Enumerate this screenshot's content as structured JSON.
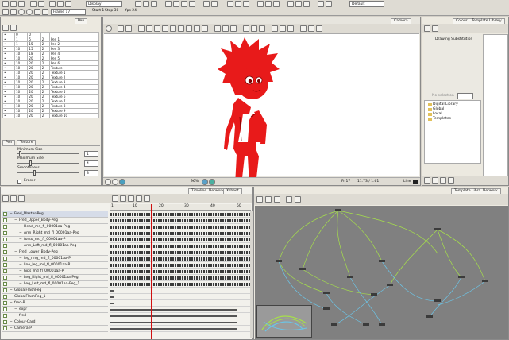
{
  "toolbar": {
    "display_label": "Display",
    "frame_label": "Frame 17",
    "start_label": "Start 1",
    "stop_label": "Stop 30",
    "fps_label": "fps 24",
    "default_label": "Default"
  },
  "pen_panel": {
    "tab_pen": "Pen",
    "rows": [
      {
        "a": "",
        "b": "0",
        "c": "0",
        "d": "",
        "name": ""
      },
      {
        "a": "",
        "b": "1",
        "c": "5",
        "d": "2",
        "name": "Pen 1"
      },
      {
        "a": "",
        "b": "1",
        "c": "15",
        "d": "2",
        "name": "Pen 2"
      },
      {
        "a": "",
        "b": "10",
        "c": "15",
        "d": "2",
        "name": "Pen 3"
      },
      {
        "a": "",
        "b": "10",
        "c": "18",
        "d": "2",
        "name": "Pen 4"
      },
      {
        "a": "",
        "b": "10",
        "c": "20",
        "d": "2",
        "name": "Pen 5"
      },
      {
        "a": "",
        "b": "10",
        "c": "20",
        "d": "2",
        "name": "Pen 6"
      },
      {
        "a": "",
        "b": "10",
        "c": "20",
        "d": "2",
        "name": "Texture"
      },
      {
        "a": "",
        "b": "10",
        "c": "20",
        "d": "2",
        "name": "Texture 1"
      },
      {
        "a": "",
        "b": "10",
        "c": "20",
        "d": "2",
        "name": "Texture 2"
      },
      {
        "a": "",
        "b": "10",
        "c": "20",
        "d": "2",
        "name": "Texture 3"
      },
      {
        "a": "",
        "b": "10",
        "c": "20",
        "d": "2",
        "name": "Texture 4"
      },
      {
        "a": "",
        "b": "10",
        "c": "20",
        "d": "2",
        "name": "Texture 5"
      },
      {
        "a": "",
        "b": "10",
        "c": "20",
        "d": "2",
        "name": "Texture 6"
      },
      {
        "a": "",
        "b": "10",
        "c": "20",
        "d": "2",
        "name": "Texture 7"
      },
      {
        "a": "",
        "b": "10",
        "c": "20",
        "d": "2",
        "name": "Texture 8"
      },
      {
        "a": "",
        "b": "10",
        "c": "20",
        "d": "2",
        "name": "Texture 9"
      },
      {
        "a": "",
        "b": "10",
        "c": "20",
        "d": "2",
        "name": "Texture 10"
      }
    ],
    "tab_pen2": "Pen",
    "tab_texture": "Texture",
    "min_size_label": "Minimum Size",
    "min_size_value": "1",
    "max_size_label": "Maximum Size",
    "max_size_value": "4",
    "smoothness_label": "Smoothness",
    "smoothness_value": "3",
    "eraser_label": "Eraser"
  },
  "camera": {
    "tab": "Camera",
    "zoom": "96%",
    "frame_readout": "Fr 17",
    "coords_readout": "11.73 / 1.61",
    "line_label": "Line"
  },
  "color_panel": {
    "tab_colour": "Colour",
    "tab_library": "Template Library",
    "drawing_substitution": "Drawing Substitution",
    "no_selection": "No selection",
    "tree": [
      "Digital Library",
      "Global",
      "Local",
      "Templates"
    ]
  },
  "timeline": {
    "tab_timeline": "Timeline",
    "tab_network": "Network",
    "tab_xsheet": "Xsheet",
    "ruler": [
      "1",
      "10",
      "20",
      "30",
      "40",
      "50"
    ],
    "current_frame": 17,
    "total_frames": 55,
    "layers": [
      {
        "name": "Fred_Master-Peg",
        "indent": 0,
        "keys": true
      },
      {
        "name": "Fred_Upper_Body-Peg",
        "indent": 1,
        "keys": true
      },
      {
        "name": "Head_md_fl_00001aa-Peg",
        "indent": 2,
        "keys": true
      },
      {
        "name": "Arm_Right_md_fl_00001aa-Peg",
        "indent": 2,
        "keys": true
      },
      {
        "name": "torso_md_fl_00001aa-P",
        "indent": 2,
        "keys": true
      },
      {
        "name": "Arm_Left_md_fl_00001aa-Peg",
        "indent": 2,
        "keys": true
      },
      {
        "name": "Fred_Lower_Body-Peg",
        "indent": 1,
        "keys": true
      },
      {
        "name": "leg_ring_md_fl_00001aa-P",
        "indent": 2,
        "keys": true
      },
      {
        "name": "line_leg_md_fl_00001aa-P",
        "indent": 2,
        "keys": true
      },
      {
        "name": "hips_md_fl_00001aa-P",
        "indent": 2,
        "keys": true
      },
      {
        "name": "Leg_Right_md_fl_00001aa-Peg",
        "indent": 2,
        "keys": true
      },
      {
        "name": "Leg_Left_md_fl_00001aa-Peg_1",
        "indent": 2,
        "keys": true
      },
      {
        "name": "GlobalFlashPeg",
        "indent": 0,
        "keys": false
      },
      {
        "name": "GlobalFlashPeg_1",
        "indent": 0,
        "keys": false
      },
      {
        "name": "fred-P",
        "indent": 0,
        "keys": false
      },
      {
        "name": "expr",
        "indent": 1,
        "keys": false
      },
      {
        "name": "fred",
        "indent": 1,
        "keys": false
      },
      {
        "name": "Colour-Card",
        "indent": 0,
        "keys": false
      },
      {
        "name": "Camera-P",
        "indent": 0,
        "keys": false
      }
    ]
  },
  "network": {
    "tab_library": "Template Library",
    "tab_network": "Network"
  },
  "colors": {
    "character_red": "#e81a1a",
    "playhead": "#d01010",
    "network_bg": "#808080",
    "wire_green": "#a6e04a",
    "wire_blue": "#6cc4e6"
  }
}
